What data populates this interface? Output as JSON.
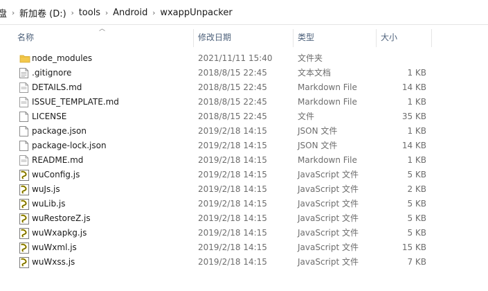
{
  "breadcrumb": {
    "items": [
      "盘",
      "新加卷 (D:)",
      "tools",
      "Android",
      "wxappUnpacker"
    ],
    "separator": "›"
  },
  "columns": {
    "name": "名称",
    "date": "修改日期",
    "type": "类型",
    "size": "大小",
    "sort": "ascending"
  },
  "files": [
    {
      "name": "node_modules",
      "date": "2021/11/11 15:40",
      "type": "文件夹",
      "size": "",
      "icon": "folder-icon"
    },
    {
      "name": ".gitignore",
      "date": "2018/8/15 22:45",
      "type": "文本文档",
      "size": "1 KB",
      "icon": "text-file-icon"
    },
    {
      "name": "DETAILS.md",
      "date": "2018/8/15 22:45",
      "type": "Markdown File",
      "size": "14 KB",
      "icon": "markdown-file-icon"
    },
    {
      "name": "ISSUE_TEMPLATE.md",
      "date": "2018/8/15 22:45",
      "type": "Markdown File",
      "size": "1 KB",
      "icon": "markdown-file-icon"
    },
    {
      "name": "LICENSE",
      "date": "2018/8/15 22:45",
      "type": "文件",
      "size": "35 KB",
      "icon": "blank-file-icon"
    },
    {
      "name": "package.json",
      "date": "2019/2/18 14:15",
      "type": "JSON 文件",
      "size": "1 KB",
      "icon": "blank-file-icon"
    },
    {
      "name": "package-lock.json",
      "date": "2019/2/18 14:15",
      "type": "JSON 文件",
      "size": "14 KB",
      "icon": "blank-file-icon"
    },
    {
      "name": "README.md",
      "date": "2019/2/18 14:15",
      "type": "Markdown File",
      "size": "1 KB",
      "icon": "markdown-file-icon"
    },
    {
      "name": "wuConfig.js",
      "date": "2019/2/18 14:15",
      "type": "JavaScript 文件",
      "size": "5 KB",
      "icon": "javascript-file-icon"
    },
    {
      "name": "wuJs.js",
      "date": "2019/2/18 14:15",
      "type": "JavaScript 文件",
      "size": "2 KB",
      "icon": "javascript-file-icon"
    },
    {
      "name": "wuLib.js",
      "date": "2019/2/18 14:15",
      "type": "JavaScript 文件",
      "size": "5 KB",
      "icon": "javascript-file-icon"
    },
    {
      "name": "wuRestoreZ.js",
      "date": "2019/2/18 14:15",
      "type": "JavaScript 文件",
      "size": "5 KB",
      "icon": "javascript-file-icon"
    },
    {
      "name": "wuWxapkg.js",
      "date": "2019/2/18 14:15",
      "type": "JavaScript 文件",
      "size": "5 KB",
      "icon": "javascript-file-icon"
    },
    {
      "name": "wuWxml.js",
      "date": "2019/2/18 14:15",
      "type": "JavaScript 文件",
      "size": "15 KB",
      "icon": "javascript-file-icon"
    },
    {
      "name": "wuWxss.js",
      "date": "2019/2/18 14:15",
      "type": "JavaScript 文件",
      "size": "7 KB",
      "icon": "javascript-file-icon"
    }
  ],
  "colors": {
    "header_text": "#4c607a",
    "folder": "#f3c84c",
    "js_icon": "#d9c200"
  }
}
